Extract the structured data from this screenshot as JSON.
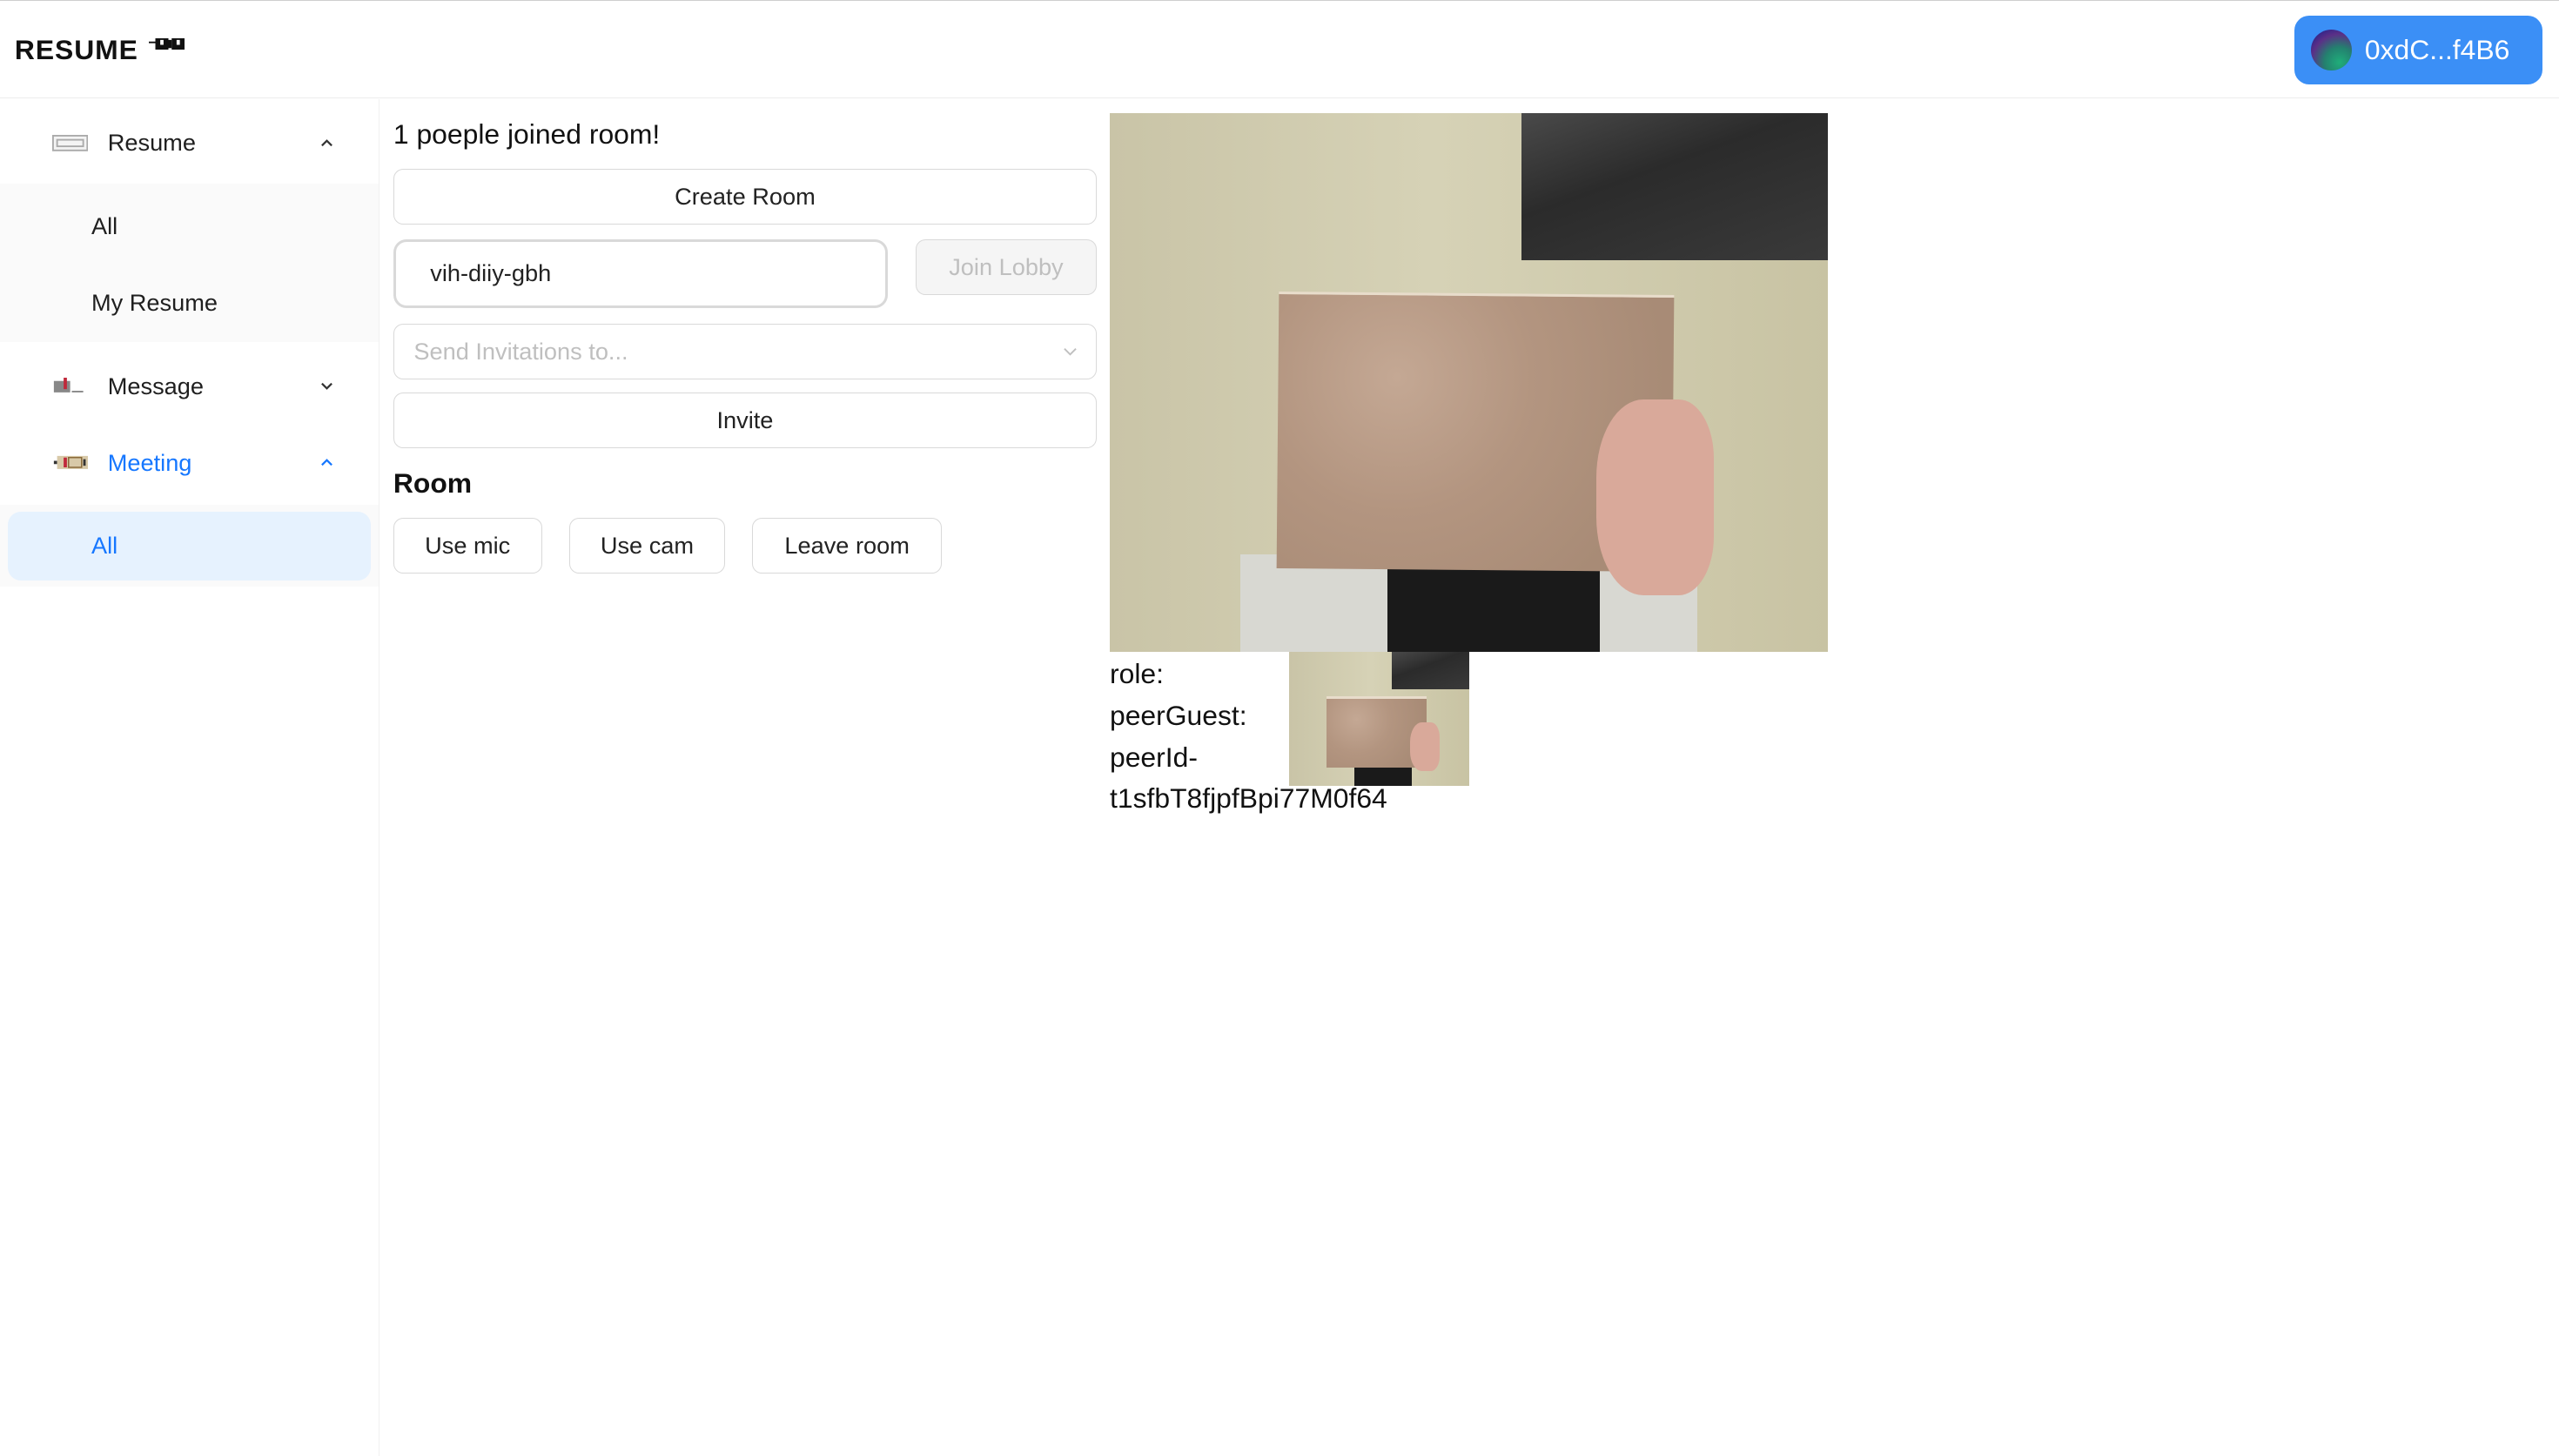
{
  "header": {
    "logo": "RESUME",
    "wallet_address": "0xdC...f4B6",
    "accent_color": "#3b8ff6"
  },
  "sidebar": {
    "groups": [
      {
        "label": "Resume",
        "icon": "resume-icon",
        "expanded": true,
        "items": [
          {
            "label": "All"
          },
          {
            "label": "My Resume"
          }
        ]
      },
      {
        "label": "Message",
        "icon": "message-icon",
        "expanded": false
      },
      {
        "label": "Meeting",
        "icon": "meeting-icon",
        "expanded": true,
        "active": true,
        "items": [
          {
            "label": "All",
            "selected": true
          }
        ]
      }
    ],
    "active_color": "#1677ff"
  },
  "main": {
    "status": "1 poeple joined room!",
    "create_room": "Create Room",
    "room_code": "vih-diiy-gbh",
    "join_lobby": "Join Lobby",
    "invite_placeholder": "Send Invitations to...",
    "invite": "Invite",
    "room_heading": "Room",
    "use_mic": "Use mic",
    "use_cam": "Use cam",
    "leave_room": "Leave room"
  },
  "peer": {
    "role": "role:",
    "guest": "peerGuest:",
    "id_prefix": "peerId-",
    "id": "t1sfbT8fjpfBpi77M0f64"
  }
}
